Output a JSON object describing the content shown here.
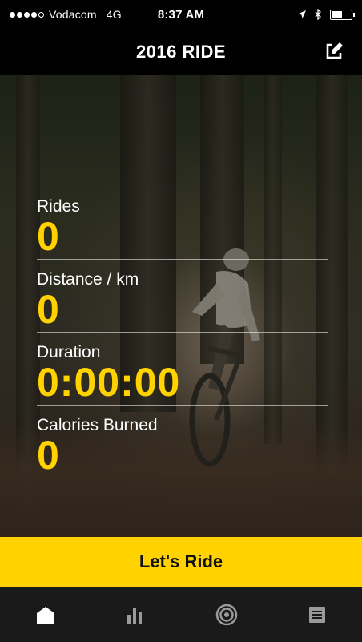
{
  "status_bar": {
    "signal_dots_filled": 4,
    "signal_dots_total": 5,
    "carrier": "Vodacom",
    "network": "4G",
    "time": "8:37 AM",
    "battery_level": 0.6,
    "icons": [
      "location-arrow-icon",
      "bluetooth-icon",
      "battery-icon"
    ]
  },
  "navbar": {
    "title": "2016 RIDE",
    "edit_icon": "edit-icon"
  },
  "stats": [
    {
      "label": "Rides",
      "value": "0"
    },
    {
      "label": "Distance / km",
      "value": "0"
    },
    {
      "label": "Duration",
      "value": "0:00:00"
    },
    {
      "label": "Calories Burned",
      "value": "0"
    }
  ],
  "cta": {
    "label": "Let's Ride"
  },
  "tabbar": {
    "tabs": [
      {
        "icon": "home-icon",
        "active": true
      },
      {
        "icon": "stats-bars-icon",
        "active": false
      },
      {
        "icon": "target-icon",
        "active": false
      },
      {
        "icon": "list-icon",
        "active": false
      }
    ]
  },
  "colors": {
    "accent": "#ffd200",
    "bar_bg": "#000000",
    "tabbar_bg": "#1a1a1a",
    "active_tab": "#ffffff",
    "inactive_tab": "#9a9a9a"
  }
}
